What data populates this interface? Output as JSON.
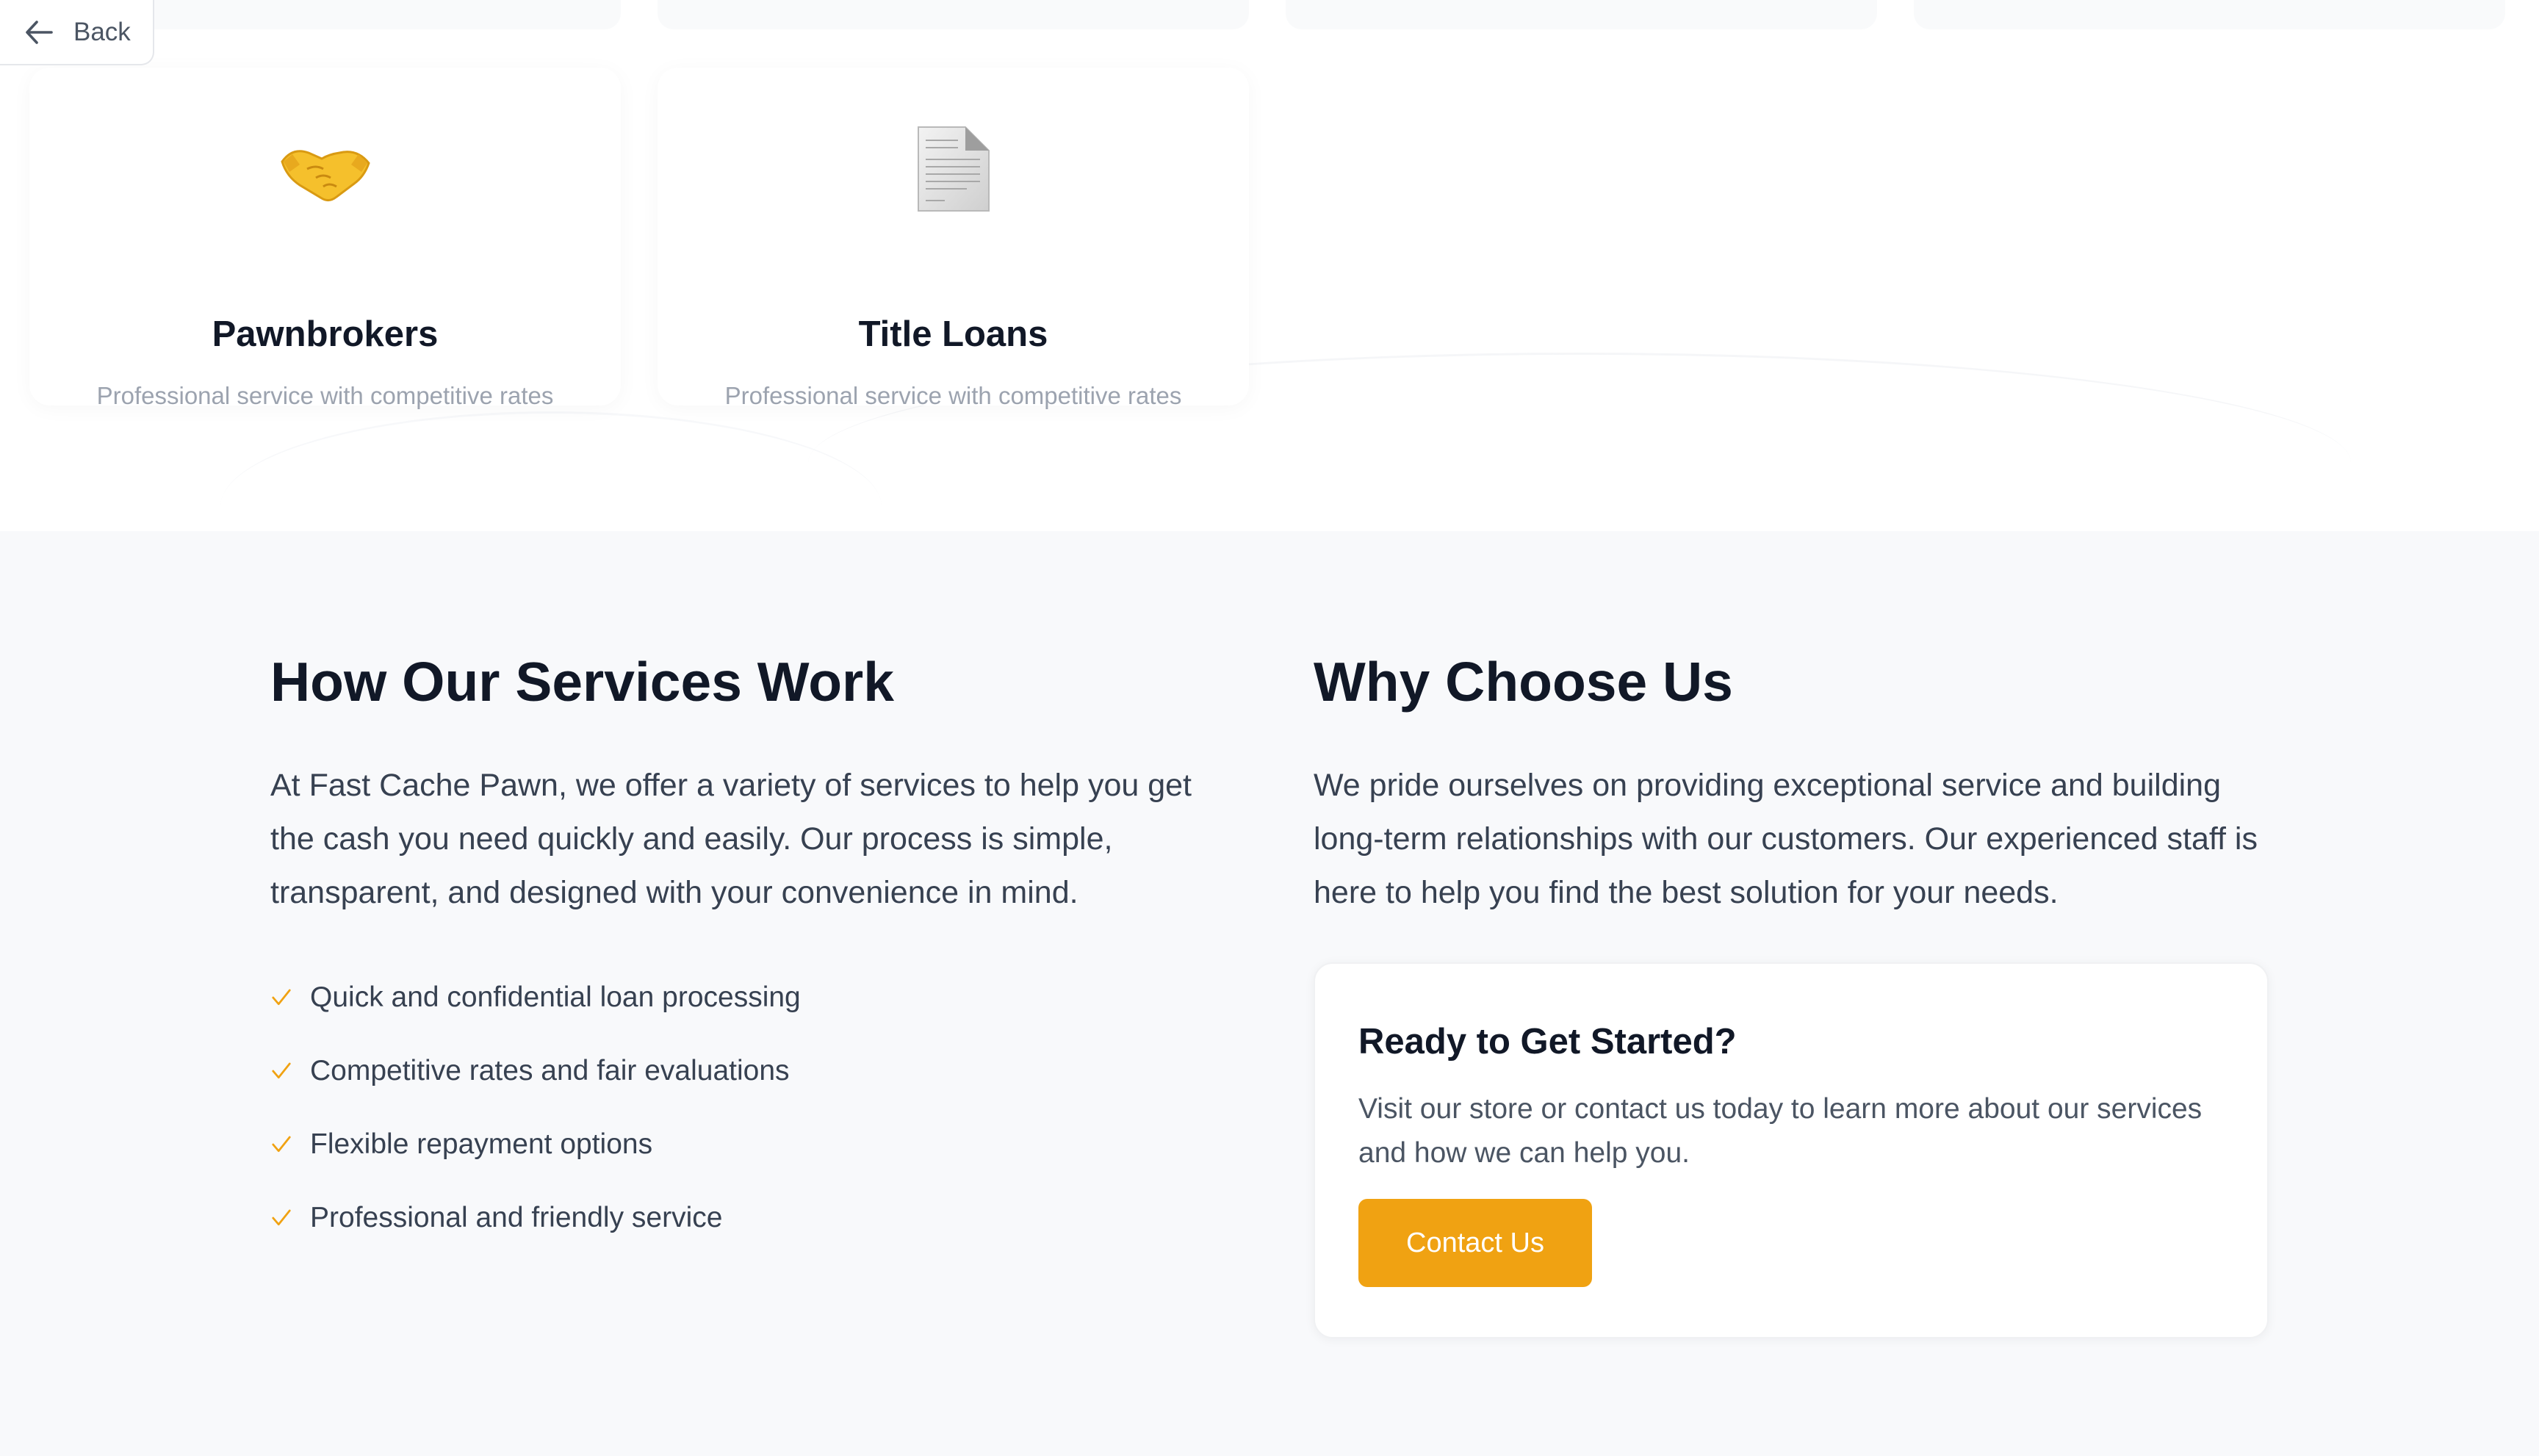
{
  "back": {
    "label": "Back"
  },
  "services": [
    {
      "title": "Pawnbrokers",
      "description": "Professional service with competitive rates",
      "icon": "handshake-emoji"
    },
    {
      "title": "Title Loans",
      "description": "Professional service with competitive rates",
      "icon": "document-emoji"
    }
  ],
  "how_it_works": {
    "heading": "How Our Services Work",
    "body": "At Fast Cache Pawn, we offer a variety of services to help you get the cash you need quickly and easily. Our process is simple, transparent, and designed with your convenience in mind.",
    "benefits": [
      "Quick and confidential loan processing",
      "Competitive rates and fair evaluations",
      "Flexible repayment options",
      "Professional and friendly service"
    ]
  },
  "why_choose": {
    "heading": "Why Choose Us",
    "body": "We pride ourselves on providing exceptional service and building long-term relationships with our customers. Our experienced staff is here to help you find the best solution for your needs.",
    "cta": {
      "title": "Ready to Get Started?",
      "body": "Visit our store or contact us today to learn more about our services and how we can help you.",
      "button_label": "Contact Us"
    }
  },
  "colors": {
    "accent": "#f0a212",
    "section_bg": "#f8f9fb",
    "heading": "#111827",
    "body_text": "#374151",
    "muted_text": "#9ca3af"
  }
}
